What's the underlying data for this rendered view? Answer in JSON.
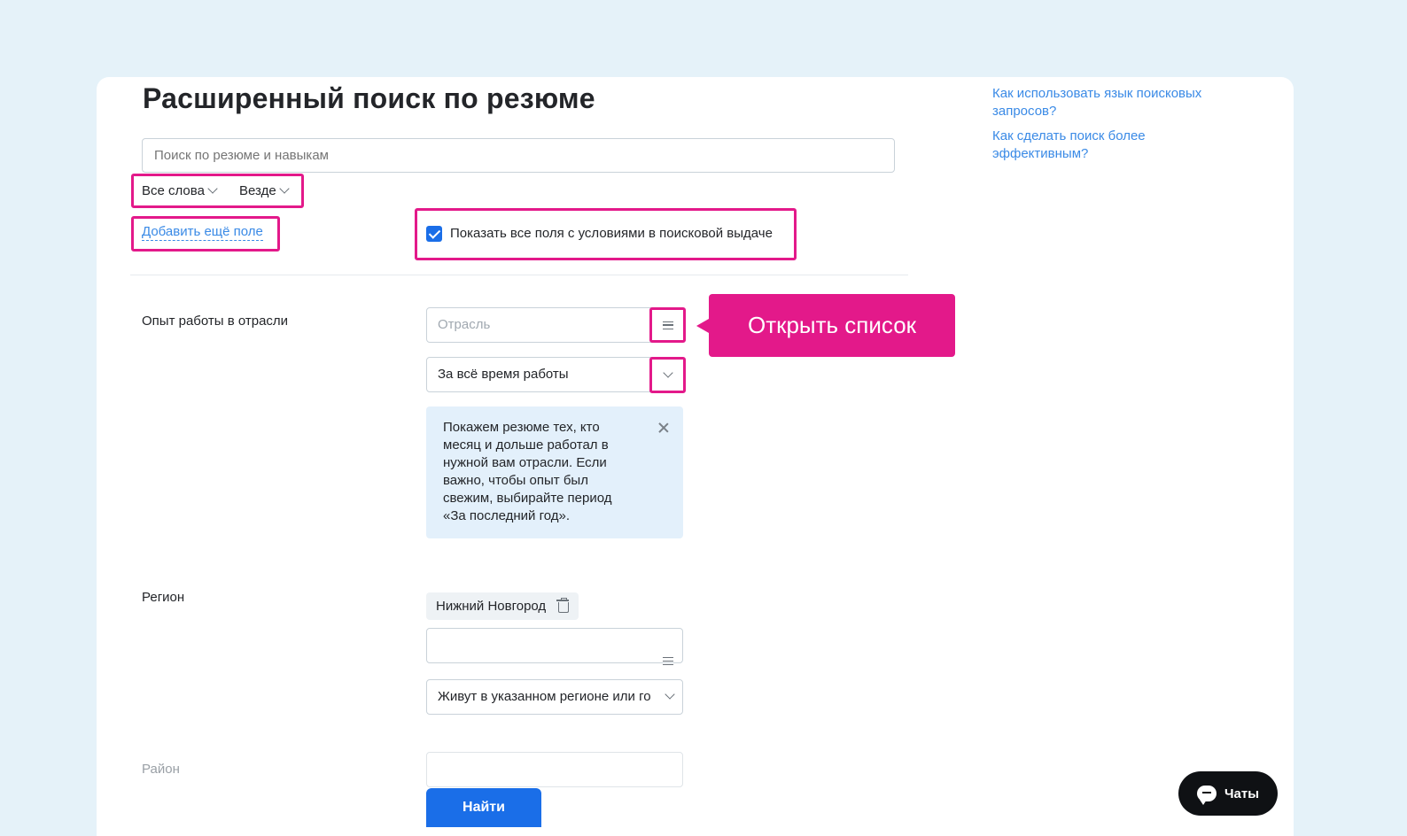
{
  "page": {
    "title": "Расширенный поиск по резюме"
  },
  "help_links": [
    "Как использовать язык поисковых запросов?",
    "Как сделать поиск более эффективным?"
  ],
  "search": {
    "placeholder": "Поиск по резюме и навыкам",
    "value": ""
  },
  "search_options": {
    "words": "Все слова",
    "where": "Везде"
  },
  "add_field_link": "Добавить ещё поле",
  "show_all_fields": {
    "label": "Показать все поля с условиями в поисковой выдаче",
    "checked": true
  },
  "industry": {
    "label": "Опыт работы в отрасли",
    "input_placeholder": "Отрасль",
    "period_value": "За всё время работы",
    "info_text": "Покажем резюме тех, кто месяц и дольше работал в нужной вам отрасли. Если важно, чтобы опыт был свежим, выбирайте период «За последний год»."
  },
  "callout": {
    "text": "Открыть список"
  },
  "region": {
    "label": "Регион",
    "selected_tag": "Нижний Новгород",
    "input_value": "",
    "relocation_value": "Живут в указанном регионе или го"
  },
  "district": {
    "label": "Район",
    "input_value": ""
  },
  "buttons": {
    "find": "Найти",
    "chats": "Чаты"
  },
  "colors": {
    "accent_blue": "#1a6ee8",
    "link_blue": "#3a8ae6",
    "highlight_pink": "#e3198a",
    "background": "#e5f2f9",
    "info_bg": "#e3f0fb"
  }
}
